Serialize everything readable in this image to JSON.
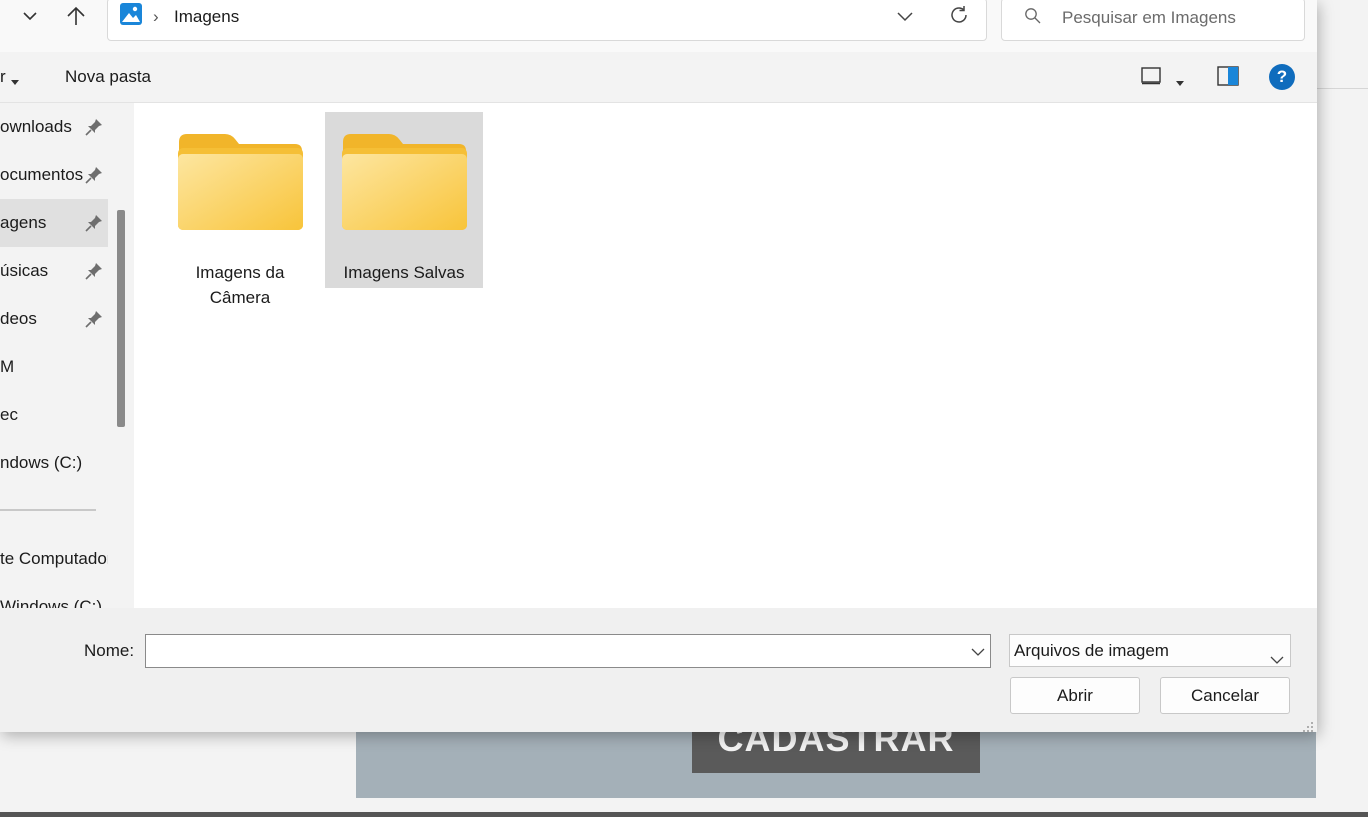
{
  "background_page": {
    "button_label": "CADASTRAR"
  },
  "dialog": {
    "address": {
      "crumb_separator": "›",
      "location": "Imagens"
    },
    "search": {
      "placeholder": "Pesquisar em Imagens"
    },
    "toolbar": {
      "organize_partial": "r",
      "new_folder": "Nova pasta"
    },
    "nav": {
      "items": [
        {
          "label": "ownloads",
          "pinned": true,
          "selected": false
        },
        {
          "label": "ocumentos",
          "pinned": true,
          "selected": false
        },
        {
          "label": "agens",
          "pinned": true,
          "selected": true
        },
        {
          "label": "úsicas",
          "pinned": true,
          "selected": false
        },
        {
          "label": "deos",
          "pinned": true,
          "selected": false
        },
        {
          "label": "M",
          "pinned": false,
          "selected": false
        },
        {
          "label": "ec",
          "pinned": false,
          "selected": false
        },
        {
          "label": "ndows (C:)",
          "pinned": false,
          "selected": false
        },
        {
          "label": "te Computador",
          "pinned": false,
          "selected": false
        },
        {
          "label": "Windows (C:)",
          "pinned": false,
          "selected": false
        }
      ]
    },
    "folders": [
      {
        "line1": "Imagens da",
        "line2": "Câmera",
        "selected": false
      },
      {
        "line1": "Imagens Salvas",
        "line2": "",
        "selected": true
      }
    ],
    "bottom": {
      "name_label": "Nome:",
      "name_value": "",
      "file_type": "Arquivos de imagem",
      "open_button": "Abrir",
      "cancel_button": "Cancelar"
    },
    "help_glyph": "?"
  },
  "colors": {
    "accent": "#0f6cbd",
    "folder_yellow": "#f8c63a",
    "selection": "#dadada"
  }
}
